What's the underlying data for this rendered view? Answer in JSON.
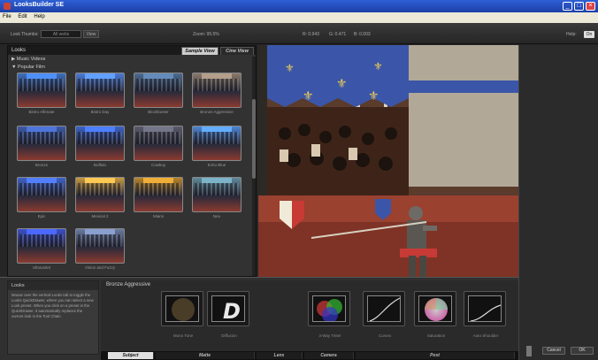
{
  "window": {
    "title": "LooksBuilder SE"
  },
  "menu": [
    "File",
    "Edit",
    "Help"
  ],
  "toolbar": {
    "look_thumbs_label": "Look Thumbs:",
    "look_thumbs_value": "All webs",
    "view_label": "View",
    "zoom": "Zoom: 95.5%",
    "r": "R: 0.943",
    "g": "G: 0.471",
    "b": "B: 0.003",
    "help_label": "Help:",
    "help_toggle": "On"
  },
  "looks_panel": {
    "title": "Looks",
    "tabs": [
      "Sample View",
      "Cine View"
    ],
    "categories": [
      "Music Videos",
      "Popular Film"
    ],
    "thumbs": [
      {
        "label": "Bistro Alfenate",
        "tint": "#3d6fbf"
      },
      {
        "label": "Bistro Day",
        "tint": "#4b7bd4"
      },
      {
        "label": "Blockbuster",
        "tint": "#4d6b8f"
      },
      {
        "label": "Bronze Aggressive",
        "tint": "#8a7a6a"
      },
      {
        "label": "Bronze",
        "tint": "#3c5aa8"
      },
      {
        "label": "Buffalo",
        "tint": "#3b62c6"
      },
      {
        "label": "Cowboy",
        "tint": "#5a5a6a"
      },
      {
        "label": "Echo Blue",
        "tint": "#4c86d4"
      },
      {
        "label": "Epic",
        "tint": "#3f62c9"
      },
      {
        "label": "Mexical 2",
        "tint": "#c89a40"
      },
      {
        "label": "Miami",
        "tint": "#b8862a"
      },
      {
        "label": "Neo",
        "tint": "#5f8a9a"
      },
      {
        "label": "Ultraviolet",
        "tint": "#3a50c8"
      },
      {
        "label": "Vision and Fuzzy",
        "tint": "#6a7ba0"
      }
    ]
  },
  "description": {
    "title": "Looks",
    "text": "Mouse over the vertical Looks tab to toggle the Looks QuickDrawer, where you can select a new Look preset. When you click on a preset in the QuickDrawer, it automatically replaces the current look in the Tool Chain."
  },
  "toolchain": {
    "title": "Bronze Aggressive",
    "tools": [
      {
        "label": "Mono Tone"
      },
      {
        "label": "Diffusion"
      },
      {
        "label": "3-Way Tinter"
      },
      {
        "label": "Curves"
      },
      {
        "label": "Saturation"
      },
      {
        "label": "Auto Shoulder"
      }
    ],
    "tabs": [
      "Subject",
      "Matte",
      "Lens",
      "Camera",
      "Post"
    ]
  },
  "buttons": {
    "cancel": "Cancel",
    "ok": "OK"
  }
}
